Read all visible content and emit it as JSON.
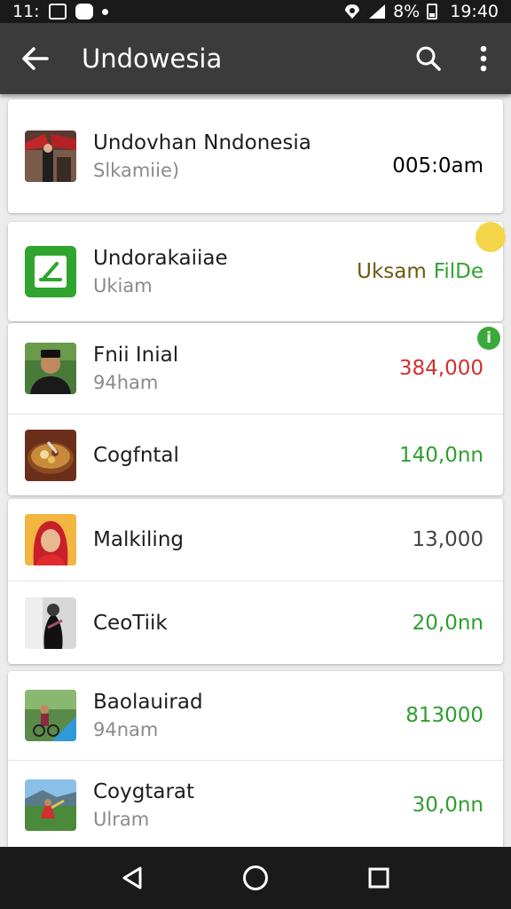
{
  "status_bar": {
    "time_left": "11:",
    "battery_percent": "8%",
    "clock": "19:40"
  },
  "app_bar": {
    "title": "Undowesia"
  },
  "cards": [
    {
      "rows": [
        {
          "title": "Undovhan Nndonesia",
          "subtitle": "Slkamiie)",
          "amount": "005:0am",
          "amount_color": "#222222",
          "thumb": "red-building-photo"
        }
      ]
    },
    {
      "rows": [
        {
          "title": "Undorakaiiae",
          "subtitle": "Ukiam",
          "amount": "Uksam",
          "amount_extra": "FilDe",
          "amount_color": "#6b5a10",
          "amount_extra_color": "#2fa52f",
          "thumb": "green-app-logo"
        }
      ]
    },
    {
      "rows": [
        {
          "title": "Fnii Inial",
          "subtitle": "94ham",
          "amount": "384,000",
          "amount_color": "#d32f2f",
          "thumb": "man-portrait-photo"
        },
        {
          "title": "Cogfntal",
          "subtitle": "",
          "amount": "140,0nn",
          "amount_color": "#2e9e2e",
          "thumb": "food-dish-photo"
        }
      ]
    },
    {
      "rows": [
        {
          "title": "Malkiling",
          "subtitle": "",
          "amount": "13,000",
          "amount_color": "#444444",
          "thumb": "woman-portrait-photo"
        },
        {
          "title": "CeoTiik",
          "subtitle": "",
          "amount": "20,0nn",
          "amount_color": "#2e9e2e",
          "thumb": "performer-photo"
        }
      ]
    },
    {
      "rows": [
        {
          "title": "Baolauirad",
          "subtitle": "94nam",
          "amount": "813000",
          "amount_color": "#2e9e2e",
          "thumb": "cyclist-photo"
        },
        {
          "title": "Coygtarat",
          "subtitle": "Ulram",
          "amount": "30,0nn",
          "amount_color": "#2e9e2e",
          "thumb": "field-photo"
        }
      ]
    }
  ],
  "badges": {
    "yellow_color": "#f5d64a",
    "green_color": "#3aaa3a",
    "green_label": "i"
  },
  "colors": {
    "app_bar": "#3b3b3b",
    "status_bar": "#1a1a1a",
    "nav_bar": "#1a1a1a"
  }
}
